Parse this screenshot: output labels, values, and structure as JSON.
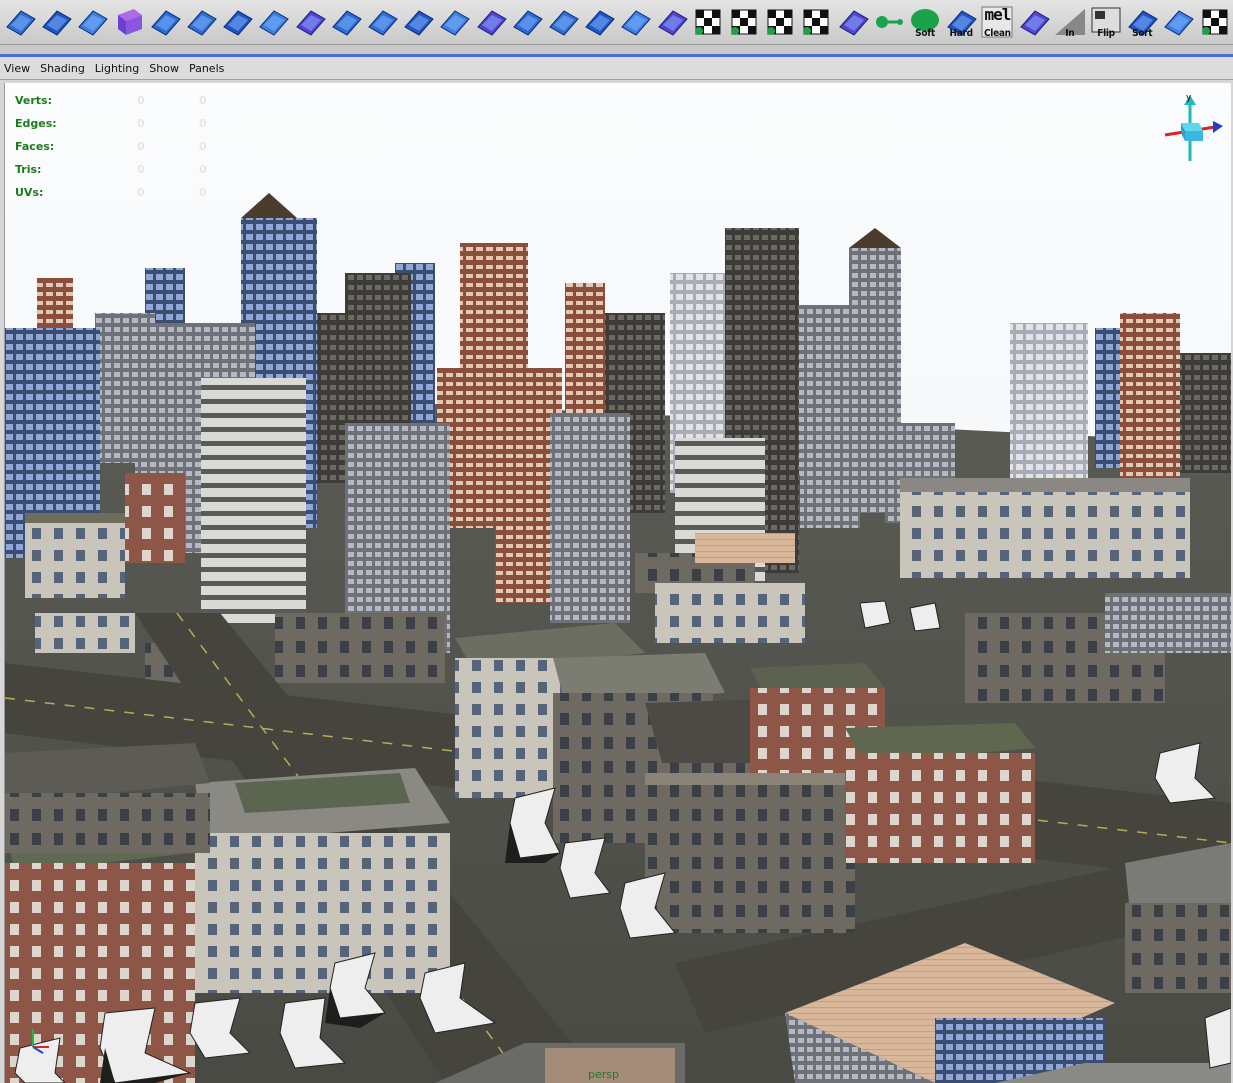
{
  "shelf": {
    "buttons": [
      {
        "name": "polygon-plane-icon",
        "label": ""
      },
      {
        "name": "polygon-cylinder-icon",
        "label": ""
      },
      {
        "name": "polygon-sphere-icon",
        "label": ""
      },
      {
        "name": "polygon-cube-icon",
        "label": ""
      },
      {
        "name": "extrude-face-icon",
        "label": ""
      },
      {
        "name": "split-polygon-icon",
        "label": ""
      },
      {
        "name": "bevel-icon",
        "label": ""
      },
      {
        "name": "merge-vertices-icon",
        "label": ""
      },
      {
        "name": "extrude-edge-icon",
        "label": ""
      },
      {
        "name": "append-polygon-icon",
        "label": ""
      },
      {
        "name": "cut-faces-icon",
        "label": ""
      },
      {
        "name": "subdivide-icon",
        "label": ""
      },
      {
        "name": "wedge-face-icon",
        "label": ""
      },
      {
        "name": "poke-face-icon",
        "label": ""
      },
      {
        "name": "duplicate-face-icon",
        "label": ""
      },
      {
        "name": "extract-icon",
        "label": ""
      },
      {
        "name": "separate-icon",
        "label": ""
      },
      {
        "name": "combine-icon",
        "label": ""
      },
      {
        "name": "center-pivot-icon",
        "label": ""
      },
      {
        "name": "planar-mapping-icon",
        "label": ""
      },
      {
        "name": "cylindrical-mapping-icon",
        "label": ""
      },
      {
        "name": "spherical-mapping-icon",
        "label": ""
      },
      {
        "name": "automatic-mapping-icon",
        "label": ""
      },
      {
        "name": "uv-texture-editor-icon",
        "label": ""
      },
      {
        "name": "connect-icon",
        "label": ""
      },
      {
        "name": "soft-edge-icon",
        "label": "Soft"
      },
      {
        "name": "hard-edge-icon",
        "label": "Hard"
      },
      {
        "name": "mel-cleanup-icon",
        "label": "Clean",
        "top": "mel"
      },
      {
        "name": "reverse-normals-icon",
        "label": ""
      },
      {
        "name": "smooth-in-icon",
        "label": "In"
      },
      {
        "name": "flip-icon",
        "label": "Flip"
      },
      {
        "name": "sort-icon",
        "label": "Sort"
      },
      {
        "name": "triangulate-icon",
        "label": ""
      },
      {
        "name": "checker-uv-icon",
        "label": ""
      }
    ]
  },
  "panel": {
    "menu": [
      "View",
      "Shading",
      "Lighting",
      "Show",
      "Panels"
    ],
    "hud": [
      {
        "label": "Verts:",
        "v1": "",
        "v2": "0",
        "v3": "0"
      },
      {
        "label": "Edges:",
        "v1": "",
        "v2": "0",
        "v3": "0"
      },
      {
        "label": "Faces:",
        "v1": "",
        "v2": "0",
        "v3": "0"
      },
      {
        "label": "Tris:",
        "v1": "",
        "v2": "0",
        "v3": "0"
      },
      {
        "label": "UVs:",
        "v1": "",
        "v2": "0",
        "v3": "0"
      }
    ],
    "camera_label": "persp",
    "view_cube_y": "y"
  },
  "colors": {
    "accent": "#4a6fd0",
    "hud_label": "#1e7a1e",
    "sky": "#f4f6f8"
  }
}
